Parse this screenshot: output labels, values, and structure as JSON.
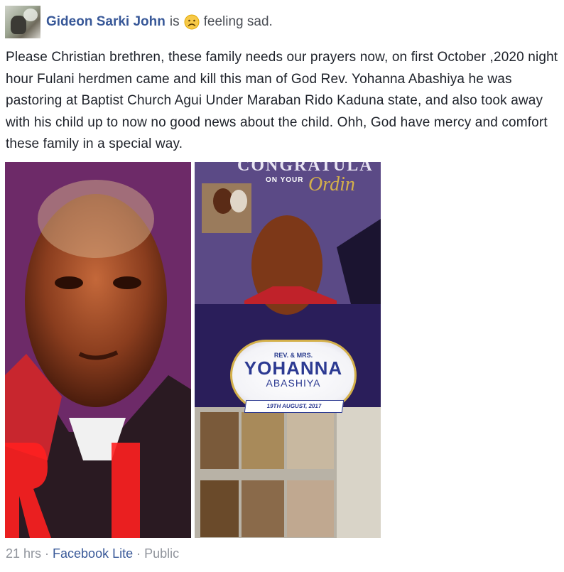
{
  "post": {
    "author": "Gideon Sarki John",
    "is_text": "is",
    "feeling": "feeling sad.",
    "feeling_icon": "sad-face-emoji",
    "body": "Please Christian brethren, these family needs our prayers now, on first October ,2020 night hour Fulani herdmen came and kill this man of God Rev. Yohanna Abashiya he was pastoring at Baptist Church Agui Under Maraban Rido Kaduna state, and also took away with his child up to now no good news about the child. Ohh, God have mercy and comfort these family in a special way."
  },
  "photo_right": {
    "banner_title": "CONGRATULA",
    "banner_sub": "ON YOUR",
    "banner_script": "Ordin",
    "badge_top": "REV. & MRS.",
    "badge_name": "YOHANNA",
    "badge_surname": "ABASHIYA",
    "badge_date": "19TH AUGUST, 2017"
  },
  "footer": {
    "time": "21 hrs",
    "sep1": " · ",
    "app": "Facebook Lite",
    "sep2": " · ",
    "audience": "Public"
  },
  "colors": {
    "link": "#385898",
    "text": "#1d2129",
    "meta": "#90949c"
  }
}
